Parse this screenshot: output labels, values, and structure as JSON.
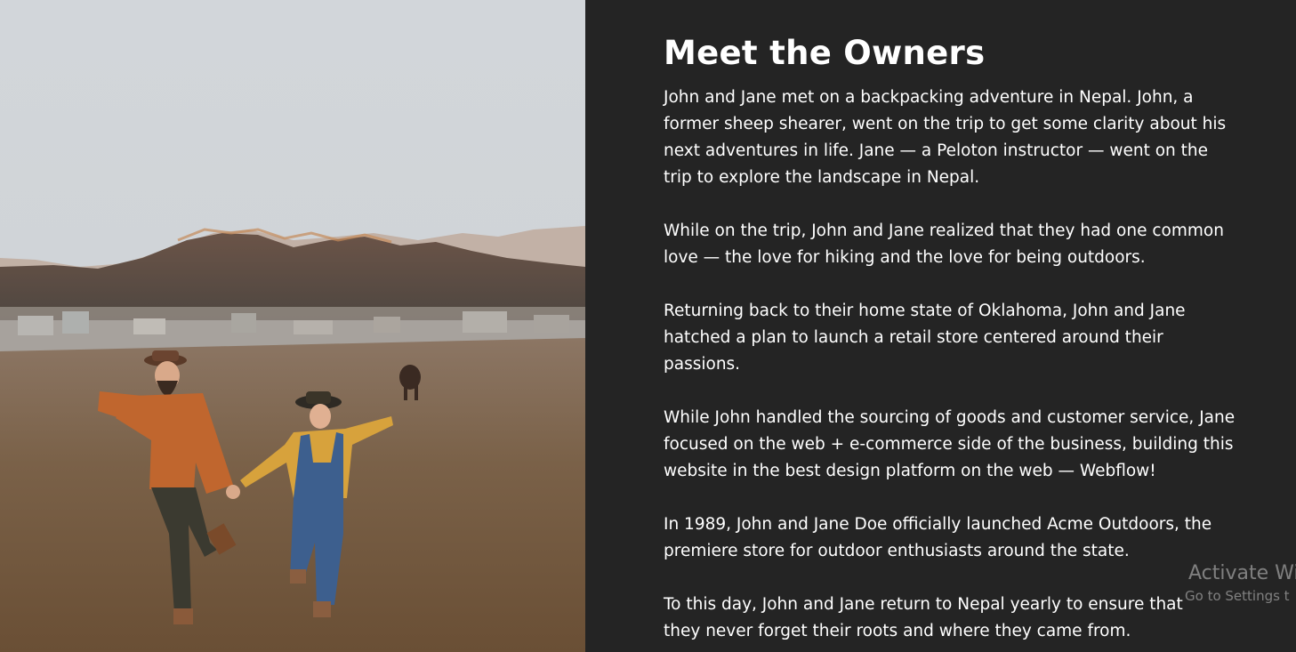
{
  "hero_image": {
    "description_icon": "photo-couple-running-field"
  },
  "about": {
    "title": "Meet the Owners",
    "paragraphs": [
      "John and Jane met on a backpacking adventure in Nepal. John, a\nformer sheep shearer, went on the trip to get some clarity about his\nnext adventures in life. Jane — a Peloton instructor — went on the\ntrip to explore the landscape in Nepal.",
      "While on the trip, John and Jane realized that they had one common\nlove — the love for hiking and the love for being outdoors.",
      "Returning back to their home state of Oklahoma, John and Jane\nhatched a plan to launch a retail store centered around their\npassions.",
      "While John handled the sourcing of goods and customer service, Jane\nfocused on the web + e-commerce side of the business, building this\nwebsite in the best design platform on the web — Webflow!",
      "In 1989, John and Jane Doe officially launched Acme Outdoors, the\npremiere store for outdoor enthusiasts around the state.",
      "To this day, John and Jane return to Nepal yearly to ensure that\nthey never forget their roots and where they came from."
    ]
  },
  "windows_watermark": {
    "title": "Activate Wi",
    "subtitle": "Go to Settings t"
  },
  "colors": {
    "background": "#242424",
    "text": "#ffffff"
  }
}
